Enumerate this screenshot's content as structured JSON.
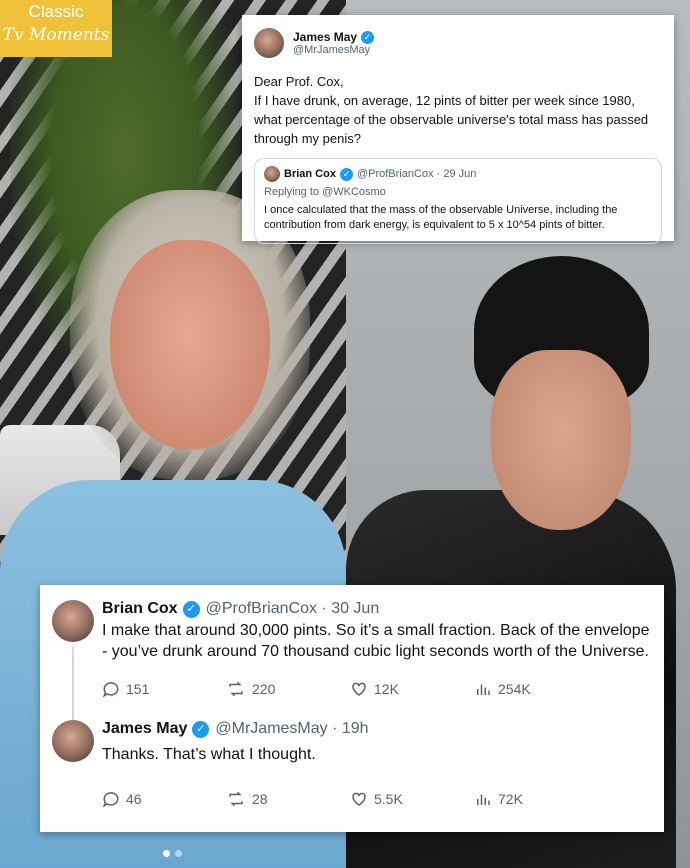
{
  "logo": {
    "line1": "Classic",
    "line2": "Tv Moments"
  },
  "top_tweet": {
    "name": "James May",
    "handle": "@MrJamesMay",
    "text": "Dear Prof. Cox,\nIf I have drunk, on average, 12 pints of bitter per week since 1980, what percentage of the observable universe's total mass has passed through my penis?",
    "quoted": {
      "name": "Brian Cox",
      "handle_time": "@ProfBrianCox · 29 Jun",
      "replying_to": "Replying to @WKCosmo",
      "text": "I once calculated that the mass of the observable Universe, including the contribution from dark energy, is equivalent to 5 x 10^54 pints of bitter."
    }
  },
  "thread": [
    {
      "name": "Brian Cox",
      "handle_time": "@ProfBrianCox · 30 Jun",
      "text": "I make that around 30,000 pints. So it’s a small fraction. Back of the envelope - you’ve drunk around 70 thousand cubic light seconds worth of the Universe.",
      "replies": "151",
      "reposts": "220",
      "likes": "12K",
      "views": "254K"
    },
    {
      "name": "James May",
      "handle_time": "@MrJamesMay · 19h",
      "text": "Thanks. That’s what I thought.",
      "replies": "46",
      "reposts": "28",
      "likes": "5.5K",
      "views": "72K"
    }
  ],
  "icons": {
    "verified": "verified-badge-icon",
    "reply": "reply-icon",
    "repost": "repost-icon",
    "like": "heart-icon",
    "views": "views-icon"
  },
  "colors": {
    "verified": "#1d9bf0",
    "logo_bg": "#f0c23a",
    "muted": "#536471"
  }
}
